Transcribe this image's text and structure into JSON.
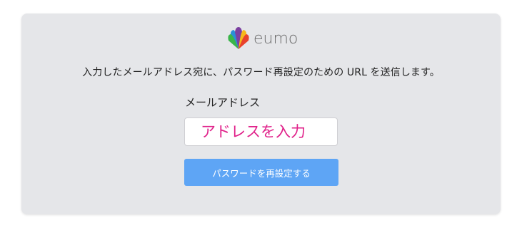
{
  "brand": {
    "logo_icon": "peacock-feather-logo-icon",
    "wordmark": "eumo",
    "colors": [
      "#e8412c",
      "#f6b81a",
      "#3ab54a",
      "#2b8fd6",
      "#7b3fa0",
      "#e0218a"
    ]
  },
  "reset_form": {
    "instruction": "入力したメールアドレス宛に、パスワード再設定のための URL を送信します。",
    "email_label": "メールアドレス",
    "email_placeholder": "アドレスを入力",
    "email_value": "",
    "submit_label": "パスワードを再設定する"
  },
  "colors": {
    "card_background": "#e5e6e9",
    "button": "#5ea5f5",
    "placeholder": "#e0218a"
  }
}
